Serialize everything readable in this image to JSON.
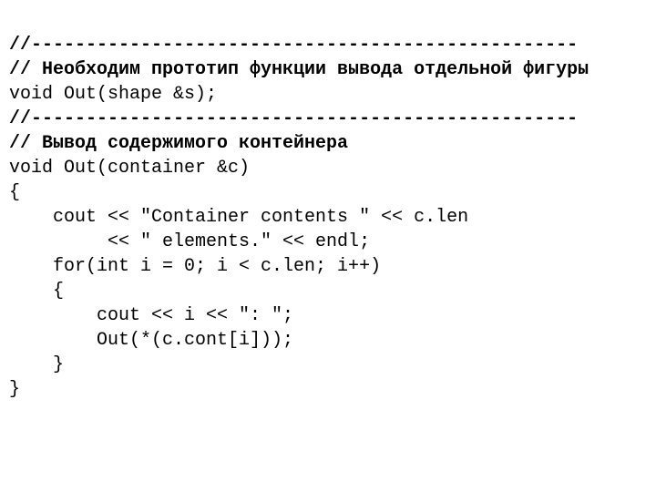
{
  "code": {
    "lines": [
      {
        "text": "//--------------------------------------------------",
        "bold": true
      },
      {
        "text": "// Необходим прототип функции вывода отдельной фигуры",
        "bold": true
      },
      {
        "text": "void Out(shape &s);",
        "bold": false
      },
      {
        "text": "//--------------------------------------------------",
        "bold": true
      },
      {
        "text": "// Вывод содержимого контейнера",
        "bold": true
      },
      {
        "text": "void Out(container &c)",
        "bold": false
      },
      {
        "text": "{",
        "bold": false
      },
      {
        "text": "    cout << \"Container contents \" << c.len",
        "bold": false
      },
      {
        "text": "         << \" elements.\" << endl;",
        "bold": false
      },
      {
        "text": "    for(int i = 0; i < c.len; i++)",
        "bold": false
      },
      {
        "text": "    {",
        "bold": false
      },
      {
        "text": "        cout << i << \": \";",
        "bold": false
      },
      {
        "text": "        Out(*(c.cont[i]));",
        "bold": false
      },
      {
        "text": "    }",
        "bold": false
      },
      {
        "text": "}",
        "bold": false
      }
    ]
  }
}
